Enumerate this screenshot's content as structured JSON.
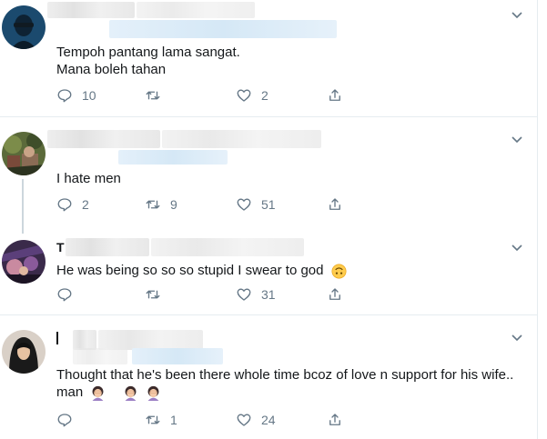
{
  "tweets": [
    {
      "text_lines": [
        "Tempoh pantang lama sangat.",
        "Mana boleh tahan"
      ],
      "replies": "10",
      "retweets": "",
      "likes": "2"
    },
    {
      "text_lines": [
        "I hate men"
      ],
      "replies": "2",
      "retweets": "9",
      "likes": "51"
    },
    {
      "name_initial": "T",
      "text_lines": [
        "He was being so so so stupid I swear to god"
      ],
      "replies": "",
      "retweets": "",
      "likes": "31"
    },
    {
      "text_lines": [
        "Thought that he's been there whole time bcoz of love n support for his wife..",
        "man"
      ],
      "replies": "",
      "retweets": "1",
      "likes": "24"
    }
  ],
  "icons": {
    "reply": "reply-icon",
    "retweet": "retweet-icon",
    "like": "heart-icon",
    "share": "share-icon",
    "more": "chevron-down-icon",
    "emoji_upside_down": "upside-down-face-emoji",
    "emoji_woman_facepalm": "woman-facepalming-emoji"
  },
  "colors": {
    "action_gray": "#657786",
    "separator": "#e6ecf0",
    "text": "#14171a"
  }
}
